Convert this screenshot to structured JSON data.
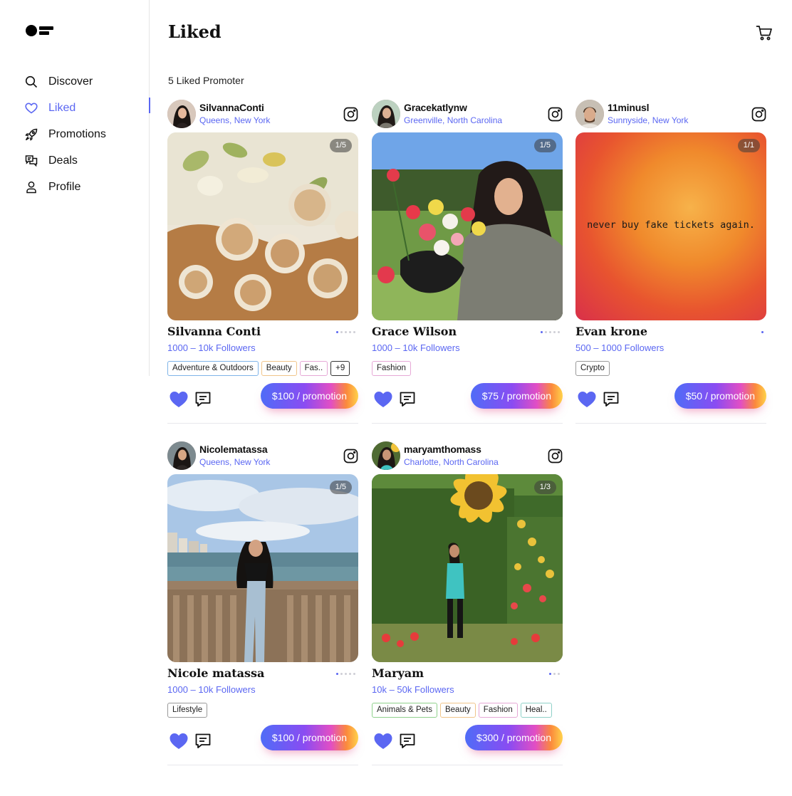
{
  "sidebar": {
    "items": [
      {
        "label": "Discover",
        "icon": "search-icon"
      },
      {
        "label": "Liked",
        "icon": "heart-icon",
        "active": true
      },
      {
        "label": "Promotions",
        "icon": "rocket-icon"
      },
      {
        "label": "Deals",
        "icon": "chat-bubbles-icon"
      },
      {
        "label": "Profile",
        "icon": "user-icon"
      }
    ]
  },
  "header": {
    "title": "Liked",
    "count_label": "5 Liked Promoter"
  },
  "colors": {
    "accent": "#5b67f2",
    "heart": "#5b67f2"
  },
  "cards": [
    {
      "handle": "SilvannaConti",
      "city": "Queens,",
      "state": "New York",
      "pager": "1/5",
      "name": "Silvanna Conti",
      "followers": "1000 – 10k Followers",
      "tags": [
        "Adventure & Outdoors",
        "Beauty",
        "Fas..",
        "+9"
      ],
      "price": "$100 / promotion",
      "dots": 5
    },
    {
      "handle": "Gracekatlynw",
      "city": "Greenville,",
      "state": "North Carolina",
      "pager": "1/5",
      "name": "Grace Wilson",
      "followers": "1000 – 10k Followers",
      "tags": [
        "Fashion"
      ],
      "price": "$75 / promotion",
      "dots": 5
    },
    {
      "handle": "11minusl",
      "city": "Sunnyside,",
      "state": "New York",
      "pager": "1/1",
      "name": "Evan krone",
      "followers": "500 – 1000 Followers",
      "tags": [
        "Crypto"
      ],
      "price": "$50 / promotion",
      "dots": 1,
      "photo_text": "never buy fake tickets again."
    },
    {
      "handle": "Nicolematassa",
      "city": "Queens,",
      "state": "New York",
      "pager": "1/5",
      "name": "Nicole matassa",
      "followers": "1000 – 10k Followers",
      "tags": [
        "Lifestyle"
      ],
      "price": "$100 / promotion",
      "dots": 5
    },
    {
      "handle": "maryamthomass",
      "city": "Charlotte,",
      "state": "North Carolina",
      "pager": "1/3",
      "name": "Maryam",
      "followers": "10k – 50k Followers",
      "tags": [
        "Animals & Pets",
        "Beauty",
        "Fashion",
        "Heal.."
      ],
      "price": "$300 / promotion",
      "dots": 3
    }
  ]
}
